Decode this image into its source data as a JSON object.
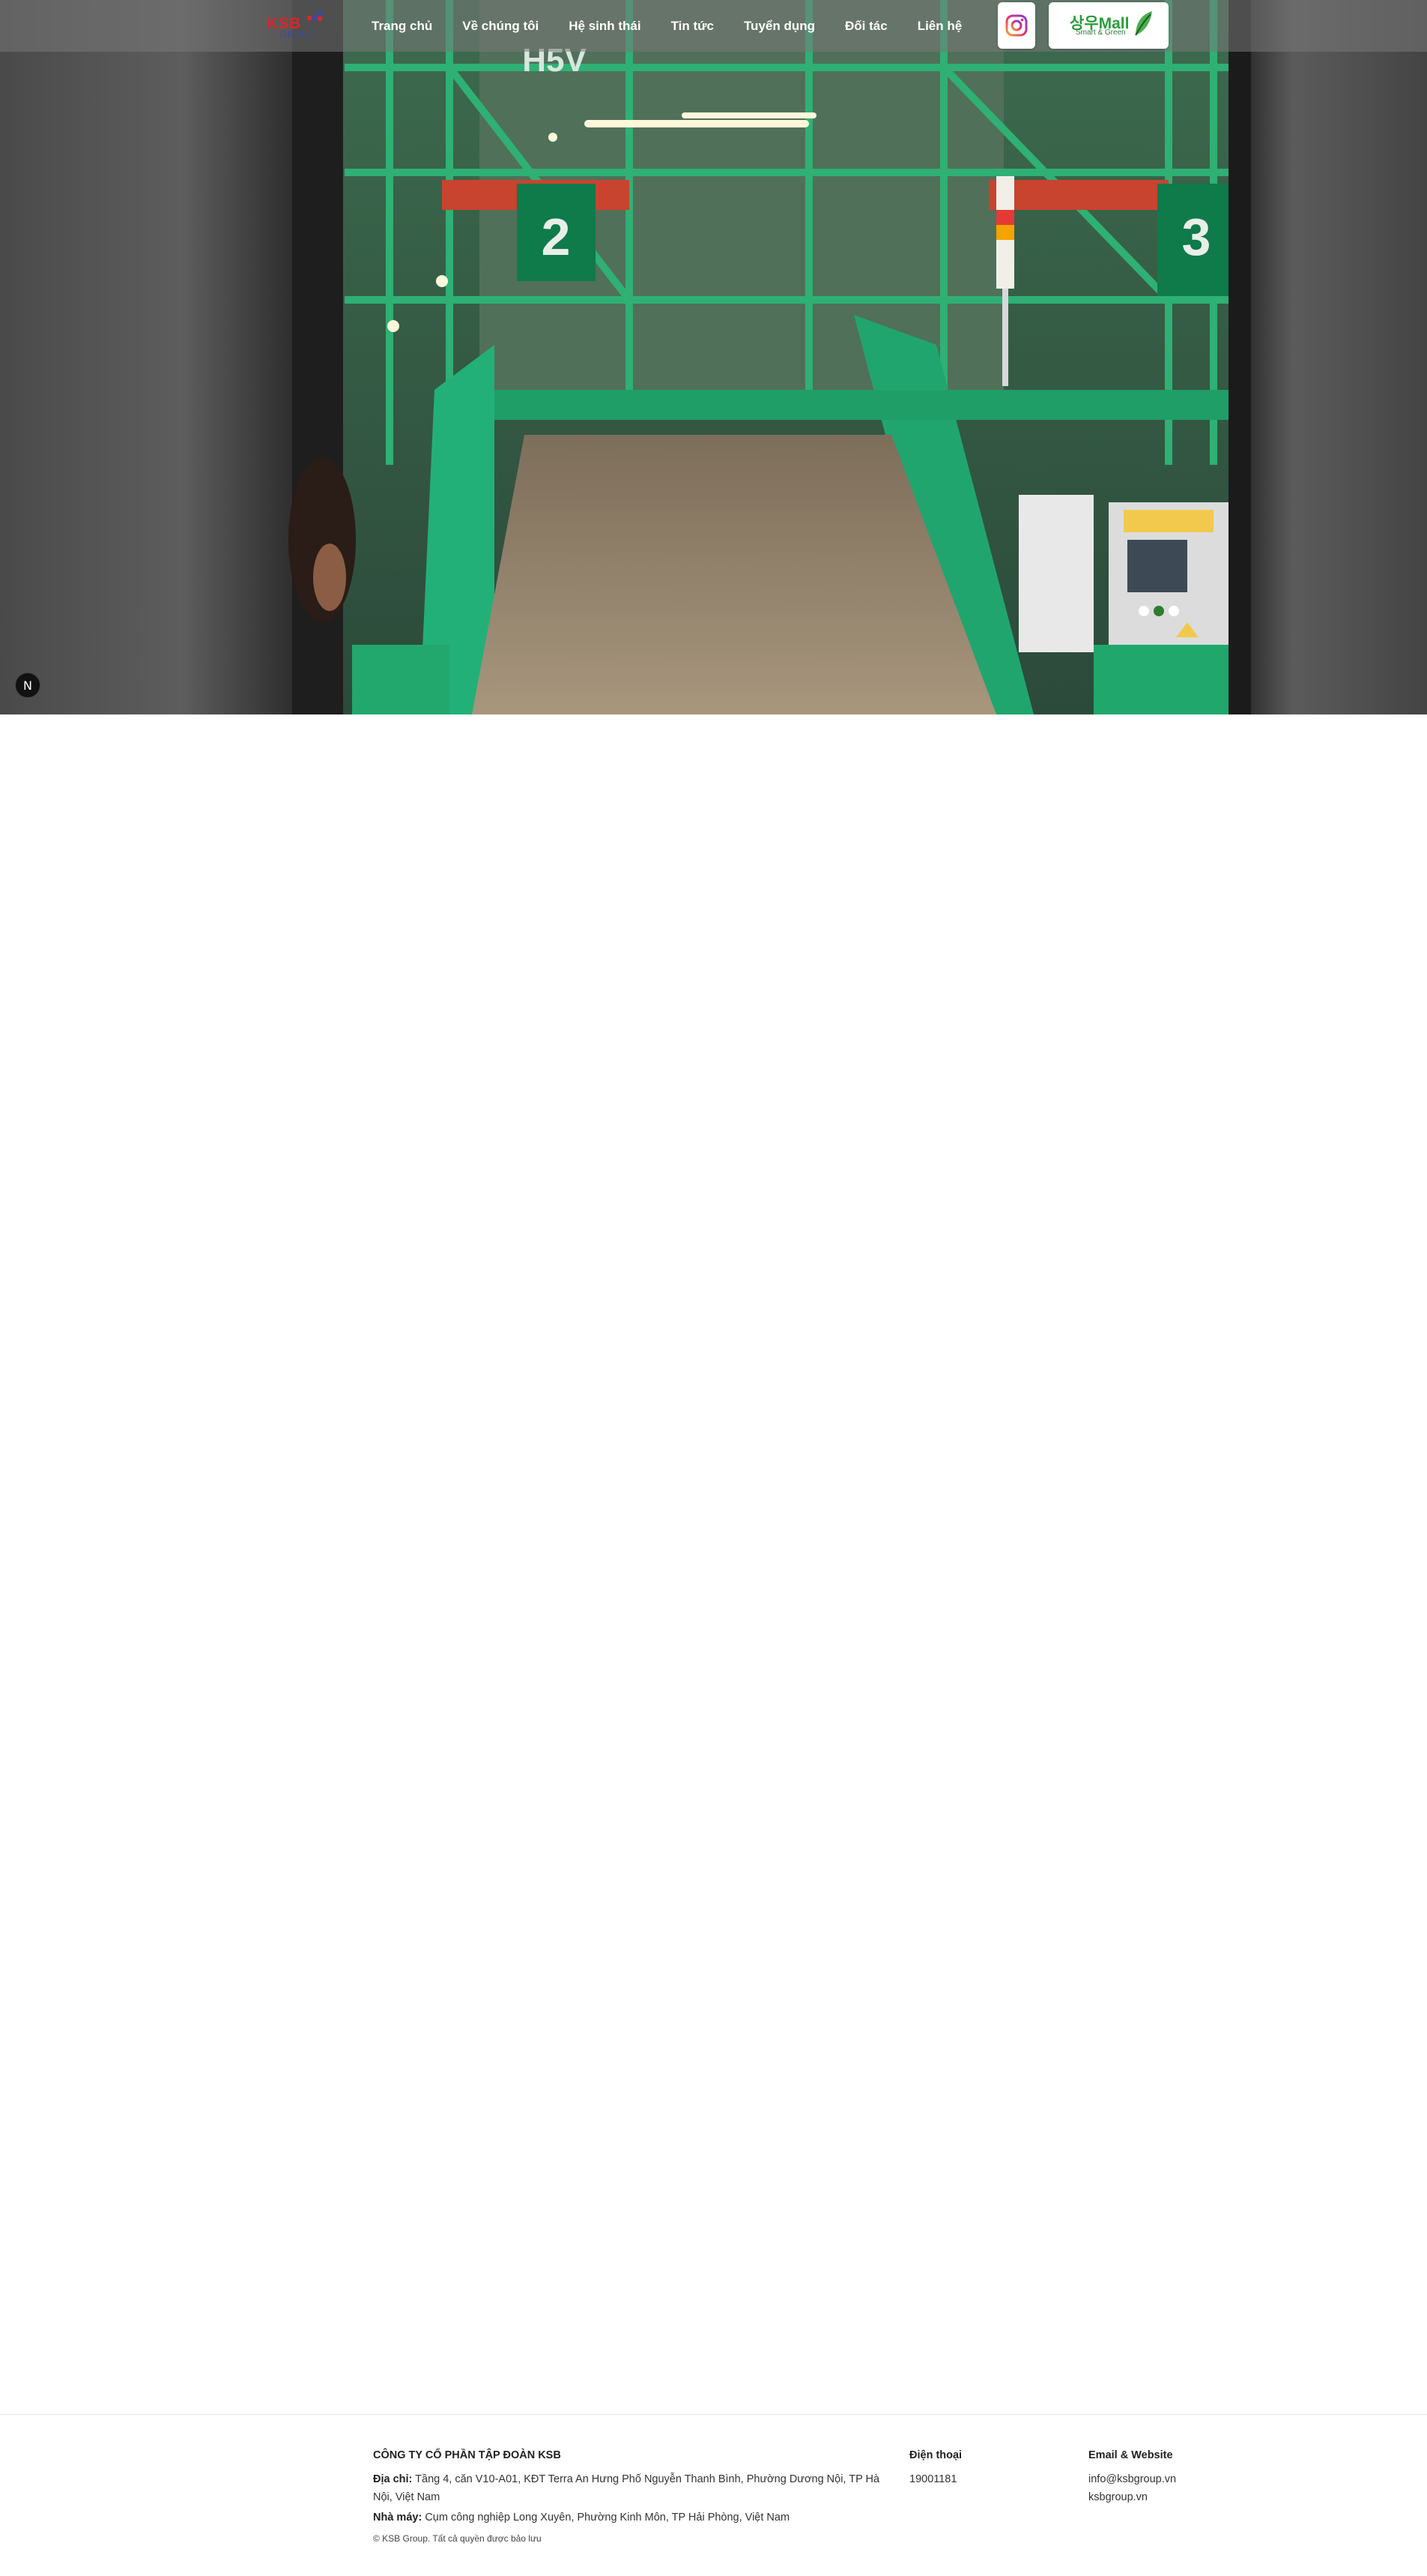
{
  "header": {
    "logo_text": "KSB",
    "logo_subtext": "GROUP",
    "nav": [
      {
        "label": "Trang chủ"
      },
      {
        "label": "Về chúng tôi"
      },
      {
        "label": "Hệ sinh thái"
      },
      {
        "label": "Tin tức"
      },
      {
        "label": "Tuyển dụng"
      },
      {
        "label": "Đối tác"
      },
      {
        "label": "Liên hệ"
      }
    ],
    "instagram_icon": "instagram-icon",
    "mall": {
      "title": "상우Mall",
      "subtitle": "Smart & Green"
    }
  },
  "hero": {
    "sign_left": "2",
    "sign_right": "3",
    "sign_top": "H5V"
  },
  "badge": {
    "label": "N"
  },
  "footer": {
    "company": "CÔNG TY CỔ PHẦN TẬP ĐOÀN KSB",
    "address_label": "Địa chỉ:",
    "address": "Tầng 4, căn V10-A01, KĐT Terra An Hưng Phố Nguyễn Thanh Bình, Phường Dương Nội, TP Hà Nội, Việt Nam",
    "factory_label": "Nhà máy:",
    "factory": "Cụm công nghiệp Long Xuyên, Phường Kinh Môn, TP Hải Phòng, Việt Nam",
    "copyright": "© KSB Group. Tất cả quyền được bảo lưu",
    "phone_heading": "Điện thoại",
    "phone": "19001181",
    "email_heading": "Email & Website",
    "email": "info@ksbgroup.vn",
    "website": "ksbgroup.vn"
  },
  "colors": {
    "brand_red": "#d9262c",
    "brand_blue": "#3b4aa2",
    "mall_green": "#2a9d3a",
    "machine_green": "#1fa56a"
  }
}
